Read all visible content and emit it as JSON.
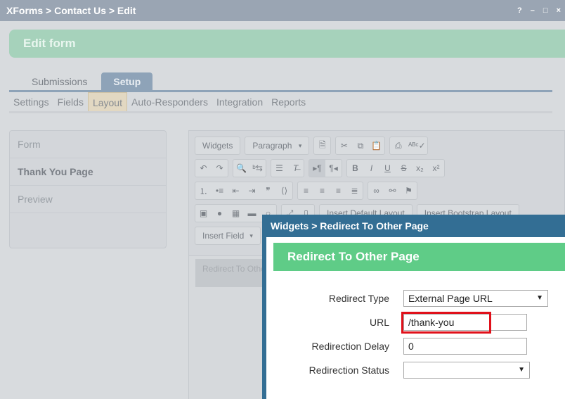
{
  "titlebar": {
    "title": "XForms > Contact Us > Edit",
    "help": "?",
    "minimize": "–",
    "maximize": "□",
    "close": "×"
  },
  "page": {
    "header": "Edit form"
  },
  "tabs": [
    {
      "label": "Submissions",
      "active": false
    },
    {
      "label": "Setup",
      "active": true
    }
  ],
  "subnav": [
    {
      "label": "Settings",
      "active": false
    },
    {
      "label": "Fields",
      "active": false
    },
    {
      "label": "Layout",
      "active": true
    },
    {
      "label": "Auto-Responders",
      "active": false
    },
    {
      "label": "Integration",
      "active": false
    },
    {
      "label": "Reports",
      "active": false
    }
  ],
  "left_panel": [
    {
      "label": "Form",
      "bold": false
    },
    {
      "label": "Thank You Page",
      "bold": true
    },
    {
      "label": "Preview",
      "bold": false
    }
  ],
  "toolbar": {
    "widgets": "Widgets",
    "paragraph": "Paragraph",
    "insert_default_layout": "Insert Default Layout",
    "insert_bootstrap_layout": "Insert Bootstrap Layout",
    "insert_field": "Insert Field"
  },
  "canvas": {
    "ghost_text": "Redirect To Othe"
  },
  "dialog": {
    "title": "Widgets > Redirect To Other Page",
    "header": "Redirect To Other Page",
    "fields": {
      "redirect_type_label": "Redirect Type",
      "redirect_type_value": "External Page URL",
      "url_label": "URL",
      "url_value": "/thank-you",
      "delay_label": "Redirection Delay",
      "delay_value": "0",
      "status_label": "Redirection Status",
      "status_value": ""
    }
  },
  "colors": {
    "titlebar": "#9aa5b3",
    "dialog_title": "#336e94",
    "dialog_header": "#5fcc87",
    "highlight": "#e0101a"
  }
}
